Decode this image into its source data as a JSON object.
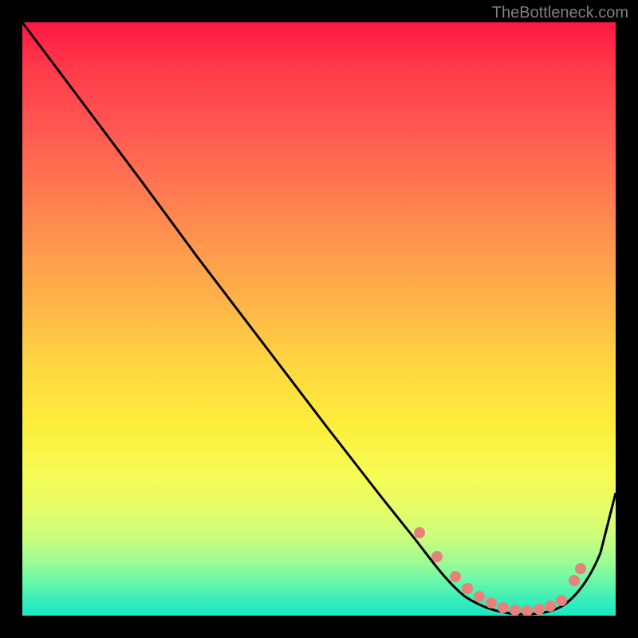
{
  "attribution": "TheBottleneck.com",
  "chart_data": {
    "type": "line",
    "title": "",
    "xlabel": "",
    "ylabel": "",
    "xlim": [
      0,
      100
    ],
    "ylim": [
      0,
      100
    ],
    "series": [
      {
        "name": "bottleneck-curve",
        "x": [
          0,
          6,
          12,
          20,
          30,
          40,
          50,
          60,
          65,
          70,
          75,
          80,
          85,
          90,
          95,
          100
        ],
        "y": [
          100,
          92,
          86,
          76,
          63,
          50,
          37,
          24,
          17,
          11,
          5,
          2,
          1,
          2,
          8,
          22
        ]
      }
    ],
    "markers": {
      "name": "optimal-range-dots",
      "x": [
        67,
        70,
        73,
        75,
        77,
        79,
        81,
        83,
        85,
        87,
        89,
        91,
        93,
        94
      ],
      "y": [
        14,
        10,
        7,
        5,
        4,
        3,
        2,
        1.5,
        1,
        1.5,
        2,
        3,
        6,
        8
      ]
    },
    "gradient_colors": {
      "top": "#ff1744",
      "middle": "#ffd740",
      "bottom": "#17e8c3"
    }
  }
}
